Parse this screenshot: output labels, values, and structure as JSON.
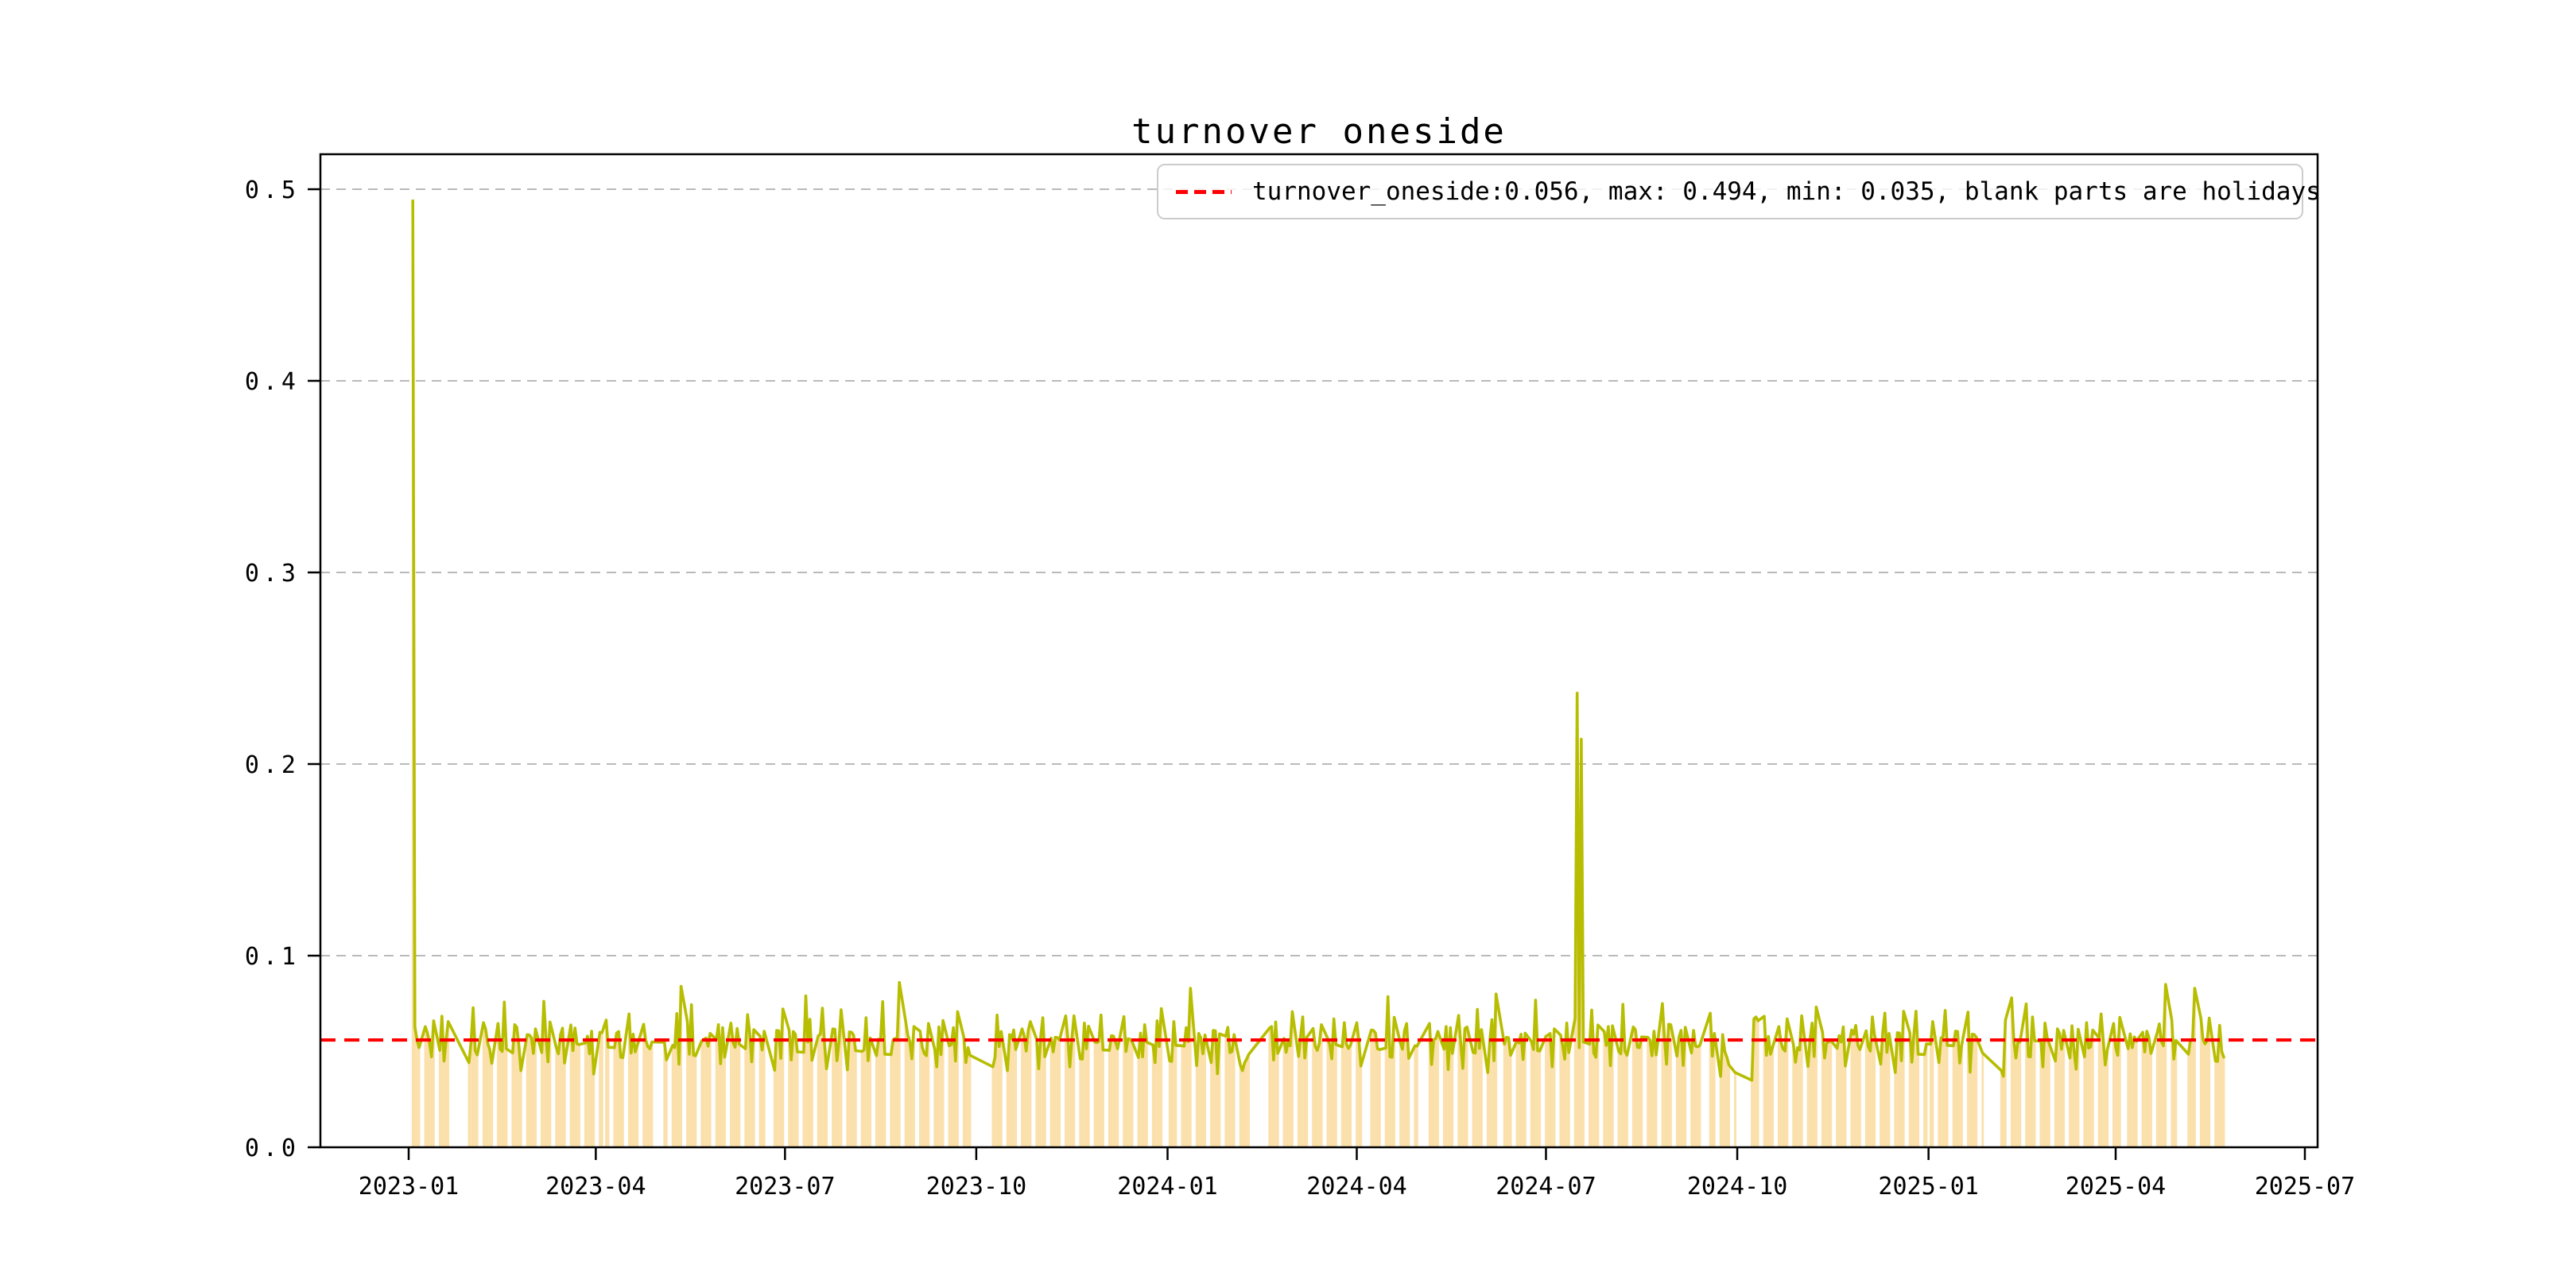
{
  "chart_data": {
    "type": "line",
    "title": "turnover oneside",
    "legend_label": "turnover_oneside:0.056, max: 0.494, min: 0.035, blank parts are holidays",
    "legend_position": "upper right",
    "grid": "horizontal-dashed",
    "stats": {
      "mean": 0.056,
      "max": 0.494,
      "min": 0.035
    },
    "mean_line_value": 0.056,
    "colors": {
      "line": "#b7bd00",
      "bars": "#fbe0ab",
      "mean_line": "#ff0000",
      "grid": "#b0b0b0",
      "axes": "#000000"
    },
    "x_axis": {
      "tick_labels": [
        "2023-01",
        "2023-04",
        "2023-07",
        "2023-10",
        "2024-01",
        "2024-04",
        "2024-07",
        "2024-10",
        "2025-01",
        "2025-04",
        "2025-07"
      ],
      "tick_dates": [
        "2023-01-01",
        "2023-04-01",
        "2023-07-01",
        "2023-10-01",
        "2024-01-01",
        "2024-04-01",
        "2024-07-01",
        "2024-10-01",
        "2025-01-01",
        "2025-04-01",
        "2025-07-01"
      ]
    },
    "y_axis": {
      "tick_labels": [
        "0.0",
        "0.1",
        "0.2",
        "0.3",
        "0.4",
        "0.5"
      ],
      "tick_values": [
        0.0,
        0.1,
        0.2,
        0.3,
        0.4,
        0.5
      ],
      "range": [
        0,
        0.517
      ]
    },
    "series": {
      "name": "turnover_oneside",
      "frequency": "trading-day",
      "start_date": "2023-01-03",
      "end_date": "2025-05-23",
      "base_pattern": [
        0.052,
        0.061,
        0.057,
        0.048,
        0.063,
        0.055,
        0.058,
        0.046,
        0.06,
        0.053,
        0.066,
        0.051,
        0.057,
        0.062,
        0.049,
        0.055,
        0.068,
        0.054,
        0.047,
        0.059,
        0.064,
        0.052,
        0.057,
        0.045,
        0.061,
        0.056,
        0.05,
        0.071,
        0.055,
        0.048,
        0.058,
        0.065,
        0.051,
        0.046,
        0.06,
        0.055,
        0.062,
        0.049,
        0.057,
        0.053,
        0.075,
        0.052,
        0.047,
        0.063,
        0.058,
        0.05,
        0.055,
        0.067,
        0.044,
        0.059,
        0.054,
        0.061,
        0.048,
        0.056,
        0.052,
        0.064,
        0.05,
        0.057,
        0.043,
        0.06,
        0.055,
        0.07,
        0.051,
        0.046,
        0.062,
        0.058,
        0.053,
        0.048,
        0.066,
        0.054,
        0.059,
        0.045,
        0.057,
        0.063,
        0.05,
        0.055,
        0.049,
        0.061,
        0.056,
        0.042,
        0.058,
        0.052,
        0.065,
        0.047,
        0.056,
        0.06,
        0.051,
        0.072,
        0.054,
        0.049
      ],
      "key_points": {
        "2023-01-03": 0.494,
        "2023-01-04": 0.063,
        "2023-01-05": 0.056,
        "2023-01-06": 0.052,
        "2023-05-12": 0.084,
        "2023-07-11": 0.079,
        "2023-08-25": 0.086,
        "2023-09-28": 0.048,
        "2023-10-09": 0.042,
        "2023-10-10": 0.047,
        "2024-01-12": 0.083,
        "2024-02-05": 0.043,
        "2024-02-06": 0.04,
        "2024-02-07": 0.044,
        "2024-02-08": 0.046,
        "2024-06-07": 0.08,
        "2024-07-16": 0.237,
        "2024-07-17": 0.052,
        "2024-07-18": 0.213,
        "2024-07-19": 0.055,
        "2024-09-25": 0.05,
        "2024-09-26": 0.047,
        "2024-09-27": 0.043,
        "2024-09-30": 0.039,
        "2024-10-08": 0.035,
        "2024-10-09": 0.067,
        "2024-10-10": 0.068,
        "2024-10-11": 0.066,
        "2025-02-05": 0.04,
        "2025-02-06": 0.037,
        "2025-02-10": 0.078,
        "2025-04-25": 0.085,
        "2025-05-09": 0.083,
        "2025-05-22": 0.05,
        "2025-05-23": 0.047
      },
      "holiday_ranges": [
        [
          "2023-01-02",
          "2023-01-02"
        ],
        [
          "2023-01-23",
          "2023-01-27"
        ],
        [
          "2023-04-05",
          "2023-04-05"
        ],
        [
          "2023-05-01",
          "2023-05-03"
        ],
        [
          "2023-06-22",
          "2023-06-23"
        ],
        [
          "2023-09-29",
          "2023-09-29"
        ],
        [
          "2023-10-02",
          "2023-10-06"
        ],
        [
          "2024-01-01",
          "2024-01-01"
        ],
        [
          "2024-02-12",
          "2024-02-16"
        ],
        [
          "2024-04-04",
          "2024-04-05"
        ],
        [
          "2024-05-01",
          "2024-05-03"
        ],
        [
          "2024-06-10",
          "2024-06-10"
        ],
        [
          "2024-09-16",
          "2024-09-17"
        ],
        [
          "2024-10-01",
          "2024-10-07"
        ],
        [
          "2025-01-01",
          "2025-01-01"
        ],
        [
          "2025-01-28",
          "2025-01-31"
        ],
        [
          "2025-02-03",
          "2025-02-04"
        ],
        [
          "2025-04-04",
          "2025-04-04"
        ],
        [
          "2025-05-01",
          "2025-05-02"
        ],
        [
          "2025-05-05",
          "2025-05-05"
        ]
      ]
    }
  }
}
